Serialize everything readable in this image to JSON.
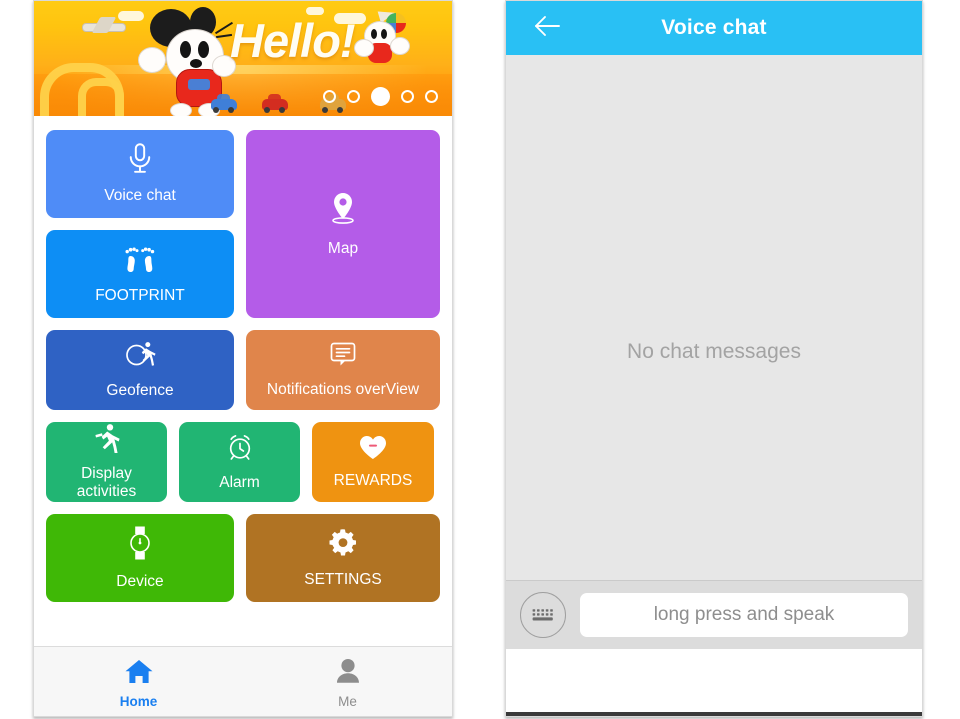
{
  "left_phone": {
    "banner": {
      "greeting": "Hello!",
      "pager_total": 5,
      "pager_active_index": 2,
      "icons": [
        "airplane-icon",
        "paper-plane-icon",
        "cloud-icon",
        "mascot-character",
        "car-icon"
      ]
    },
    "tiles": [
      {
        "id": "voice-chat",
        "label": "Voice chat",
        "icon": "microphone-icon",
        "color": "#4f8cf7"
      },
      {
        "id": "map",
        "label": "Map",
        "icon": "map-pin-icon",
        "color": "#b45ce8"
      },
      {
        "id": "footprint",
        "label": "FOOTPRINT",
        "icon": "footprints-icon",
        "color": "#0d8ef5"
      },
      {
        "id": "geofence",
        "label": "Geofence",
        "icon": "geofence-icon",
        "color": "#2f62c4"
      },
      {
        "id": "notifications",
        "label": "Notifications overView",
        "icon": "message-icon",
        "color": "#e0854b"
      },
      {
        "id": "display-activities",
        "label": "Display\nactivities",
        "icon": "running-icon",
        "color": "#21b573"
      },
      {
        "id": "alarm",
        "label": "Alarm",
        "icon": "alarm-clock-icon",
        "color": "#21b573"
      },
      {
        "id": "rewards",
        "label": "REWARDS",
        "icon": "heart-icon",
        "color": "#ef9311"
      },
      {
        "id": "device",
        "label": "Device",
        "icon": "watch-icon",
        "color": "#3fb806"
      },
      {
        "id": "settings",
        "label": "SETTINGS",
        "icon": "gear-icon",
        "color": "#b07323"
      }
    ],
    "tabbar": {
      "items": [
        {
          "id": "home",
          "label": "Home",
          "icon": "home-icon",
          "active": true,
          "color": "#1a7ff0"
        },
        {
          "id": "me",
          "label": "Me",
          "icon": "person-icon",
          "active": false,
          "color": "#8d8d8d"
        }
      ]
    }
  },
  "right_phone": {
    "appbar": {
      "title": "Voice chat",
      "back_icon": "back-arrow-icon",
      "background": "#29c0f4"
    },
    "chat": {
      "empty_state": "No chat messages",
      "background": "#e7e7e7"
    },
    "input_bar": {
      "keyboard_icon": "keyboard-icon",
      "speak_button_label": "long press and speak",
      "background": "#dcdcdc"
    }
  }
}
